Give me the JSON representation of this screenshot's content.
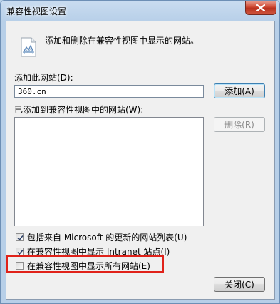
{
  "window": {
    "title": "兼容性视图设置",
    "close_icon": "close-icon"
  },
  "description": "添加和删除在兼容性视图中显示的网站。",
  "add_section": {
    "label": "添加此网站(D):",
    "input_value": "360.cn",
    "add_button": "添加(A)"
  },
  "list_section": {
    "label": "已添加到兼容性视图中的网站(W):",
    "items": [],
    "remove_button": "删除(R)"
  },
  "checkboxes": [
    {
      "label": "包括来自 Microsoft 的更新的网站列表(U)",
      "checked": true
    },
    {
      "label": "在兼容性视图中显示 Intranet 站点(I)",
      "checked": true
    },
    {
      "label": "在兼容性视图中显示所有网站(E)",
      "checked": false
    }
  ],
  "close_button": "关闭(C)",
  "colors": {
    "highlight": "#e0221a",
    "titlebar": "#b7cfe8",
    "close_button": "#cf4b35"
  }
}
